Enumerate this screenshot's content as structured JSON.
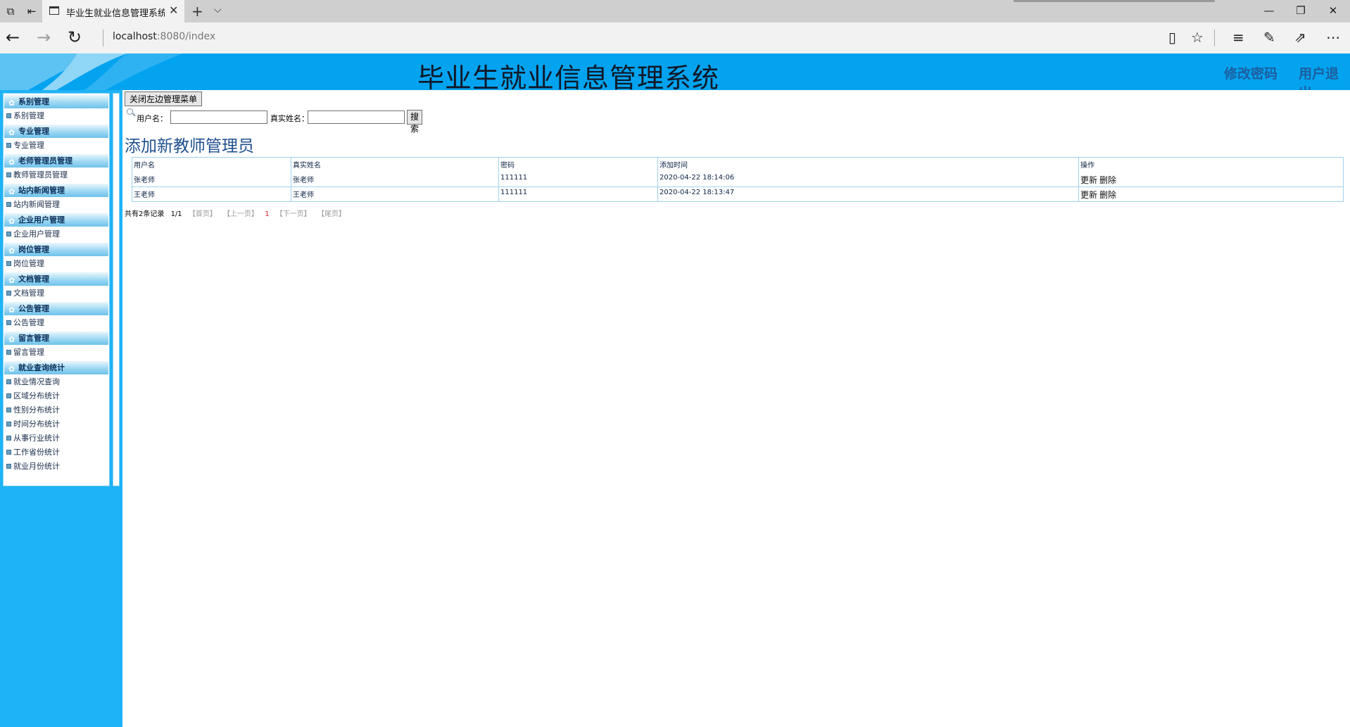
{
  "browser": {
    "tab_title": "毕业生就业信息管理系统",
    "url_host": "localhost",
    "url_rest": ":8080/index"
  },
  "header": {
    "title": "毕业生就业信息管理系统",
    "change_password": "修改密码",
    "logout": "用户退出"
  },
  "sidebar": {
    "groups": [
      {
        "title": "系别管理",
        "items": [
          "系别管理"
        ]
      },
      {
        "title": "专业管理",
        "items": [
          "专业管理"
        ]
      },
      {
        "title": "老师管理员管理",
        "items": [
          "教师管理员管理"
        ]
      },
      {
        "title": "站内新闻管理",
        "items": [
          "站内新闻管理"
        ]
      },
      {
        "title": "企业用户管理",
        "items": [
          "企业用户管理"
        ]
      },
      {
        "title": "岗位管理",
        "items": [
          "岗位管理"
        ]
      },
      {
        "title": "文档管理",
        "items": [
          "文档管理"
        ]
      },
      {
        "title": "公告管理",
        "items": [
          "公告管理"
        ]
      },
      {
        "title": "留言管理",
        "items": [
          "留言管理"
        ]
      },
      {
        "title": "就业查询统计",
        "items": [
          "就业情况查询",
          "区域分布统计",
          "性别分布统计",
          "时间分布统计",
          "从事行业统计",
          "工作省份统计",
          "就业月份统计"
        ]
      }
    ]
  },
  "main": {
    "toggle_menu": "关闭左边管理菜单",
    "search": {
      "username_label": "用户名：",
      "username_value": "",
      "realname_label": "真实姓名：",
      "realname_value": "",
      "button": "搜索"
    },
    "add_link": "添加新教师管理员",
    "table": {
      "headers": [
        "用户名",
        "真实姓名",
        "密码",
        "添加时间",
        "操作"
      ],
      "rows": [
        {
          "username": "张老师",
          "realname": "张老师",
          "password": "111111",
          "added": "2020-04-22 18:14:06",
          "update": "更新",
          "delete": "删除"
        },
        {
          "username": "王老师",
          "realname": "王老师",
          "password": "111111",
          "added": "2020-04-22 18:13:47",
          "update": "更新",
          "delete": "删除"
        }
      ]
    },
    "pager": {
      "total": "共有2条记录",
      "page": "1/1",
      "first": "【首页】",
      "prev": "【上一页】",
      "current": "1",
      "next": "【下一页】",
      "last": "【尾页】"
    }
  }
}
